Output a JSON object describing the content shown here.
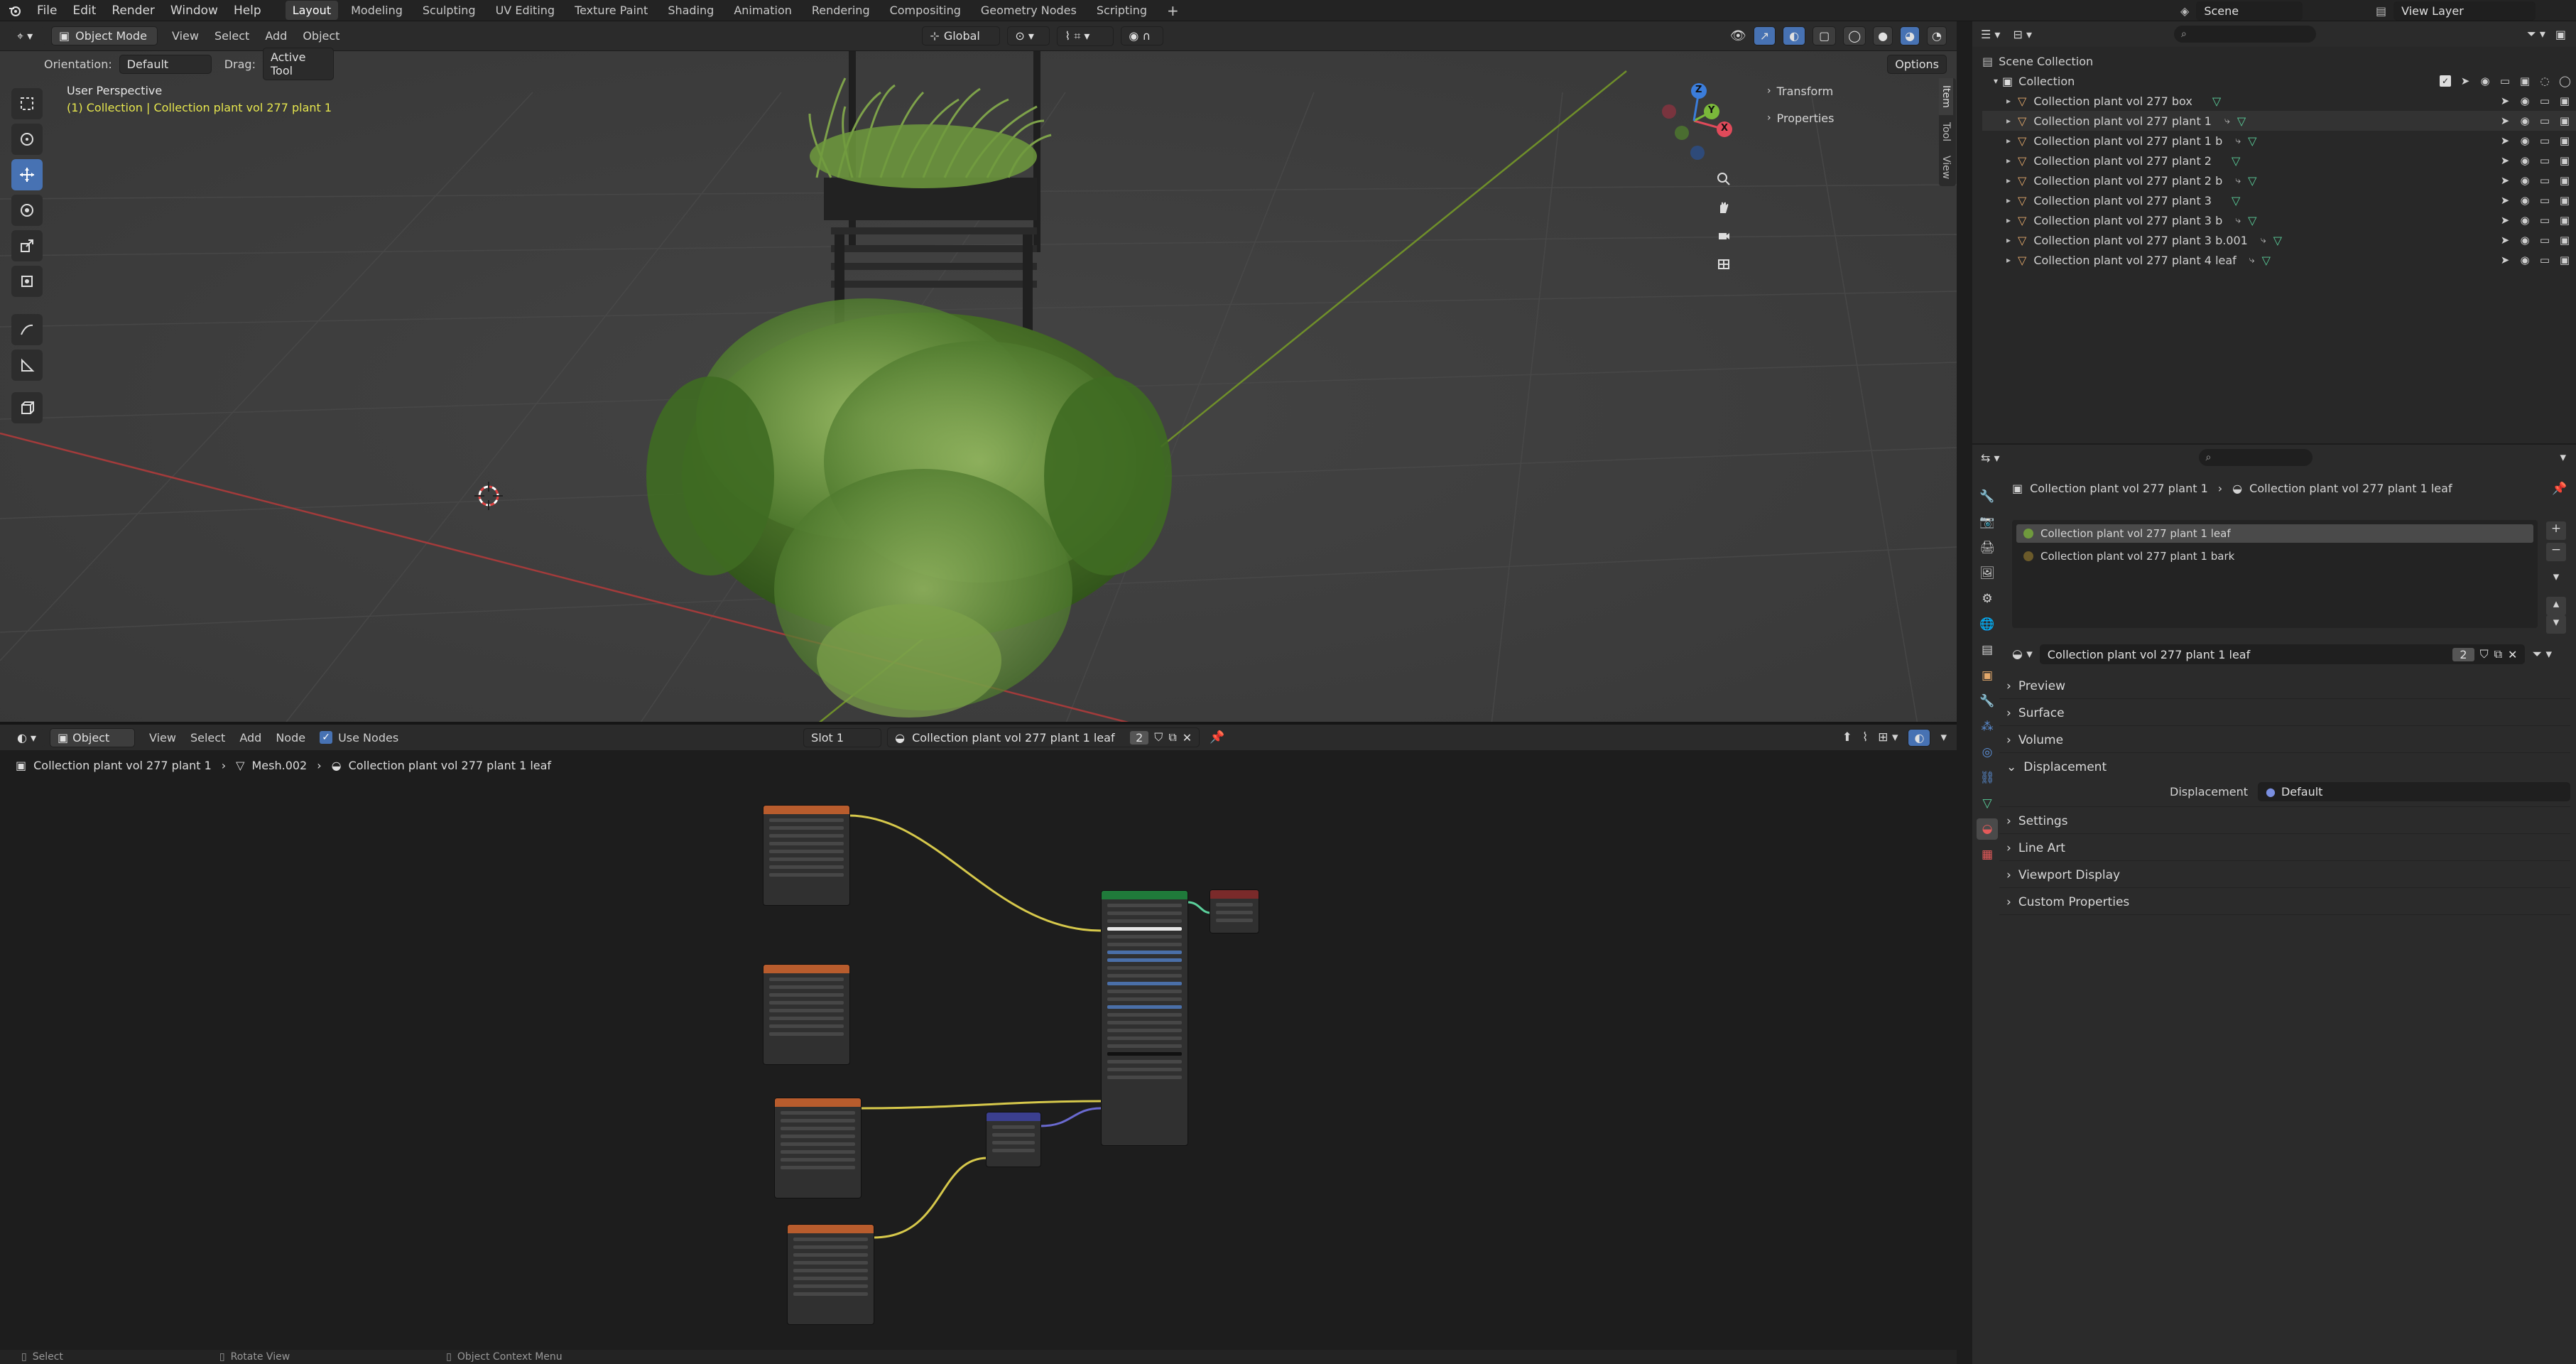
{
  "menubar": {
    "menus": [
      "File",
      "Edit",
      "Render",
      "Window",
      "Help"
    ],
    "workspaces": [
      "Layout",
      "Modeling",
      "Sculpting",
      "UV Editing",
      "Texture Paint",
      "Shading",
      "Animation",
      "Rendering",
      "Compositing",
      "Geometry Nodes",
      "Scripting"
    ],
    "scene": "Scene",
    "view_layer": "View Layer"
  },
  "viewport": {
    "mode": "Object Mode",
    "menus": [
      "View",
      "Select",
      "Add",
      "Object"
    ],
    "transform_orientation": "Global",
    "orientation_label": "Orientation:",
    "orientation_value": "Default",
    "drag_label": "Drag:",
    "drag_value": "Active Tool",
    "options": "Options",
    "overlay_title": "User Perspective",
    "overlay_subtitle": "(1) Collection | Collection plant vol 277 plant 1",
    "npanel": {
      "transform": "Transform",
      "properties": "Properties",
      "tabs": [
        "Item",
        "Tool",
        "View"
      ]
    },
    "gizmo": {
      "x": "X",
      "y": "Y",
      "z": "Z"
    }
  },
  "outliner": {
    "root": "Scene Collection",
    "collection": "Collection",
    "items": [
      "Collection plant vol 277 box",
      "Collection plant vol 277 plant 1",
      "Collection plant vol 277 plant 1 b",
      "Collection plant vol 277 plant 2",
      "Collection plant vol 277 plant 2 b",
      "Collection plant vol 277 plant 3",
      "Collection plant vol 277 plant 3 b",
      "Collection plant vol 277 plant 3 b.001",
      "Collection plant vol 277 plant 4 leaf"
    ]
  },
  "properties": {
    "breadcrumb": [
      "Collection plant vol 277 plant 1",
      "Collection plant vol 277 plant 1 leaf"
    ],
    "material_slots": [
      "Collection plant vol 277 plant 1 leaf",
      "Collection plant vol 277 plant 1 bark"
    ],
    "material_name": "Collection plant vol 277 plant 1 leaf",
    "user_count": "2",
    "panels": [
      "Preview",
      "Surface",
      "Volume",
      "Displacement",
      "Settings",
      "Line Art",
      "Viewport Display",
      "Custom Properties"
    ],
    "displacement_label": "Displacement",
    "displacement_value": "Default"
  },
  "node_editor": {
    "mode": "Object",
    "menus": [
      "View",
      "Select",
      "Add",
      "Node"
    ],
    "use_nodes": "Use Nodes",
    "slot": "Slot 1",
    "material_name": "Collection plant vol 277 plant 1 leaf",
    "user_count": "2",
    "breadcrumb": [
      "Collection plant vol 277 plant 1",
      "Mesh.002",
      "Collection plant vol 277 plant 1 leaf"
    ]
  },
  "statusbar": {
    "items": [
      "Select",
      "Rotate View",
      "Object Context Menu"
    ]
  },
  "colors": {
    "accent": "#4772b3",
    "collection_orange": "#e3a86b",
    "mesh_green": "#5bd19c",
    "selection_yellow": "#e6e64e",
    "image_node_header": "#b85c2d",
    "bsdf_header": "#1f7a3a",
    "normal_map_header": "#3b3f8f"
  }
}
